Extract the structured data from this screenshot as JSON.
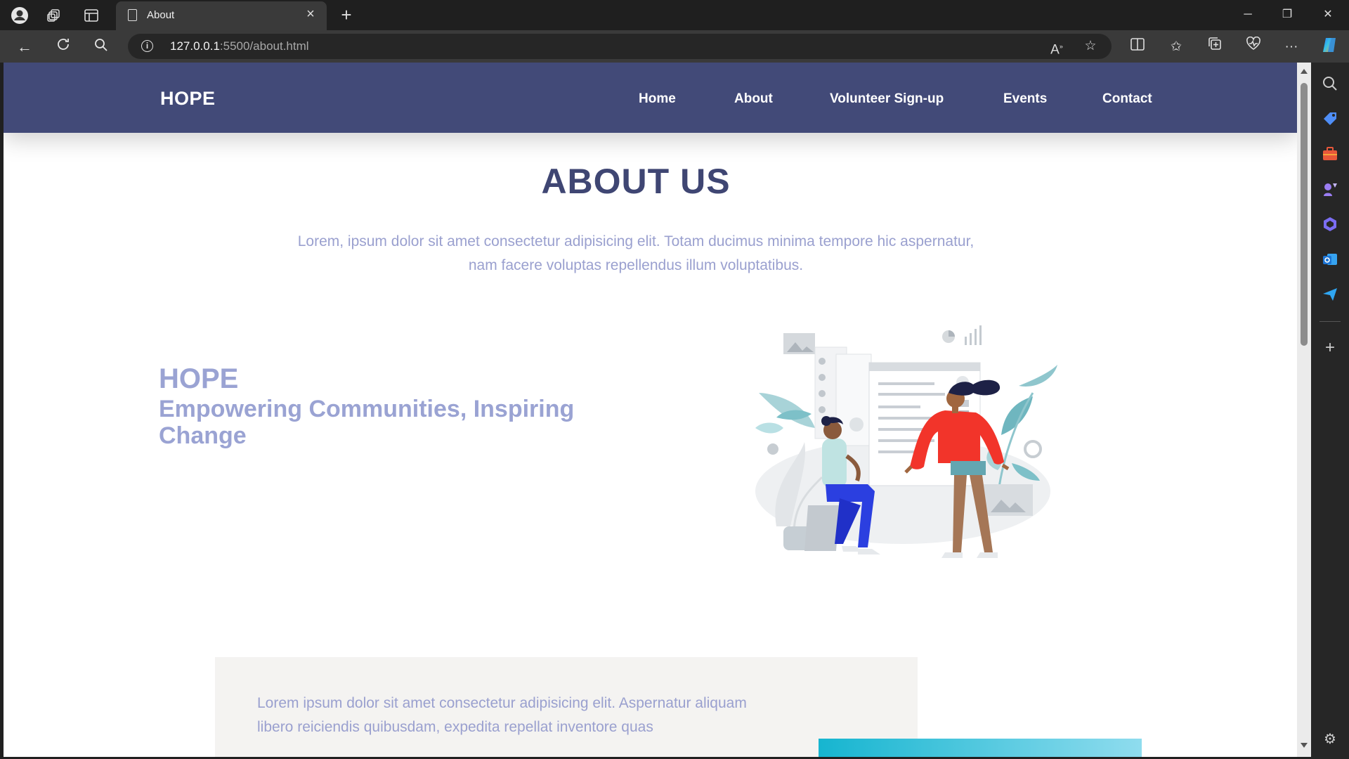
{
  "browser": {
    "tab_title": "About",
    "url_host": "127.0.0.1",
    "url_rest": ":5500/about.html",
    "new_tab_symbol": "+",
    "icons": [
      "profile-icon",
      "workspaces-icon",
      "tab-actions-icon",
      "back-icon",
      "refresh-icon",
      "search-icon",
      "info-icon",
      "read-aloud-icon",
      "favorite-star-icon",
      "split-screen-icon",
      "favorites-icon",
      "collections-icon",
      "browser-essentials-icon",
      "more-icon",
      "copilot-icon"
    ]
  },
  "sidebar": {
    "icons": [
      "sidebar-search-icon",
      "shopping-icon",
      "tools-icon",
      "games-icon",
      "copilot-sidebar-icon",
      "outlook-icon",
      "send-icon",
      "add-icon",
      "settings-icon"
    ],
    "colors": {
      "shopping": "#4f8ef7",
      "tools": "#e8573a",
      "games": "#9b7df2",
      "copilot": "#7b6df2",
      "outlook": "#1c74d4",
      "send": "#2fa6f2"
    }
  },
  "site": {
    "brand": "HOPE",
    "nav": [
      "Home",
      "About",
      "Volunteer Sign-up",
      "Events",
      "Contact"
    ],
    "nav_color": "#424a78"
  },
  "about": {
    "title": "ABOUT US",
    "intro": "Lorem, ipsum dolor sit amet consectetur adipisicing elit. Totam ducimus minima tempore hic aspernatur, nam facere voluptas repellendus illum voluptatibus.",
    "hero_name": "HOPE",
    "hero_tagline": "Empowering Communities, Inspiring Change",
    "illustration": "two-people-dashboard-illustration"
  },
  "info": {
    "text": "Lorem ipsum dolor sit amet consectetur adipisicing elit. Aspernatur aliquam libero reiciendis quibusdam, expedita repellat inventore quas"
  }
}
